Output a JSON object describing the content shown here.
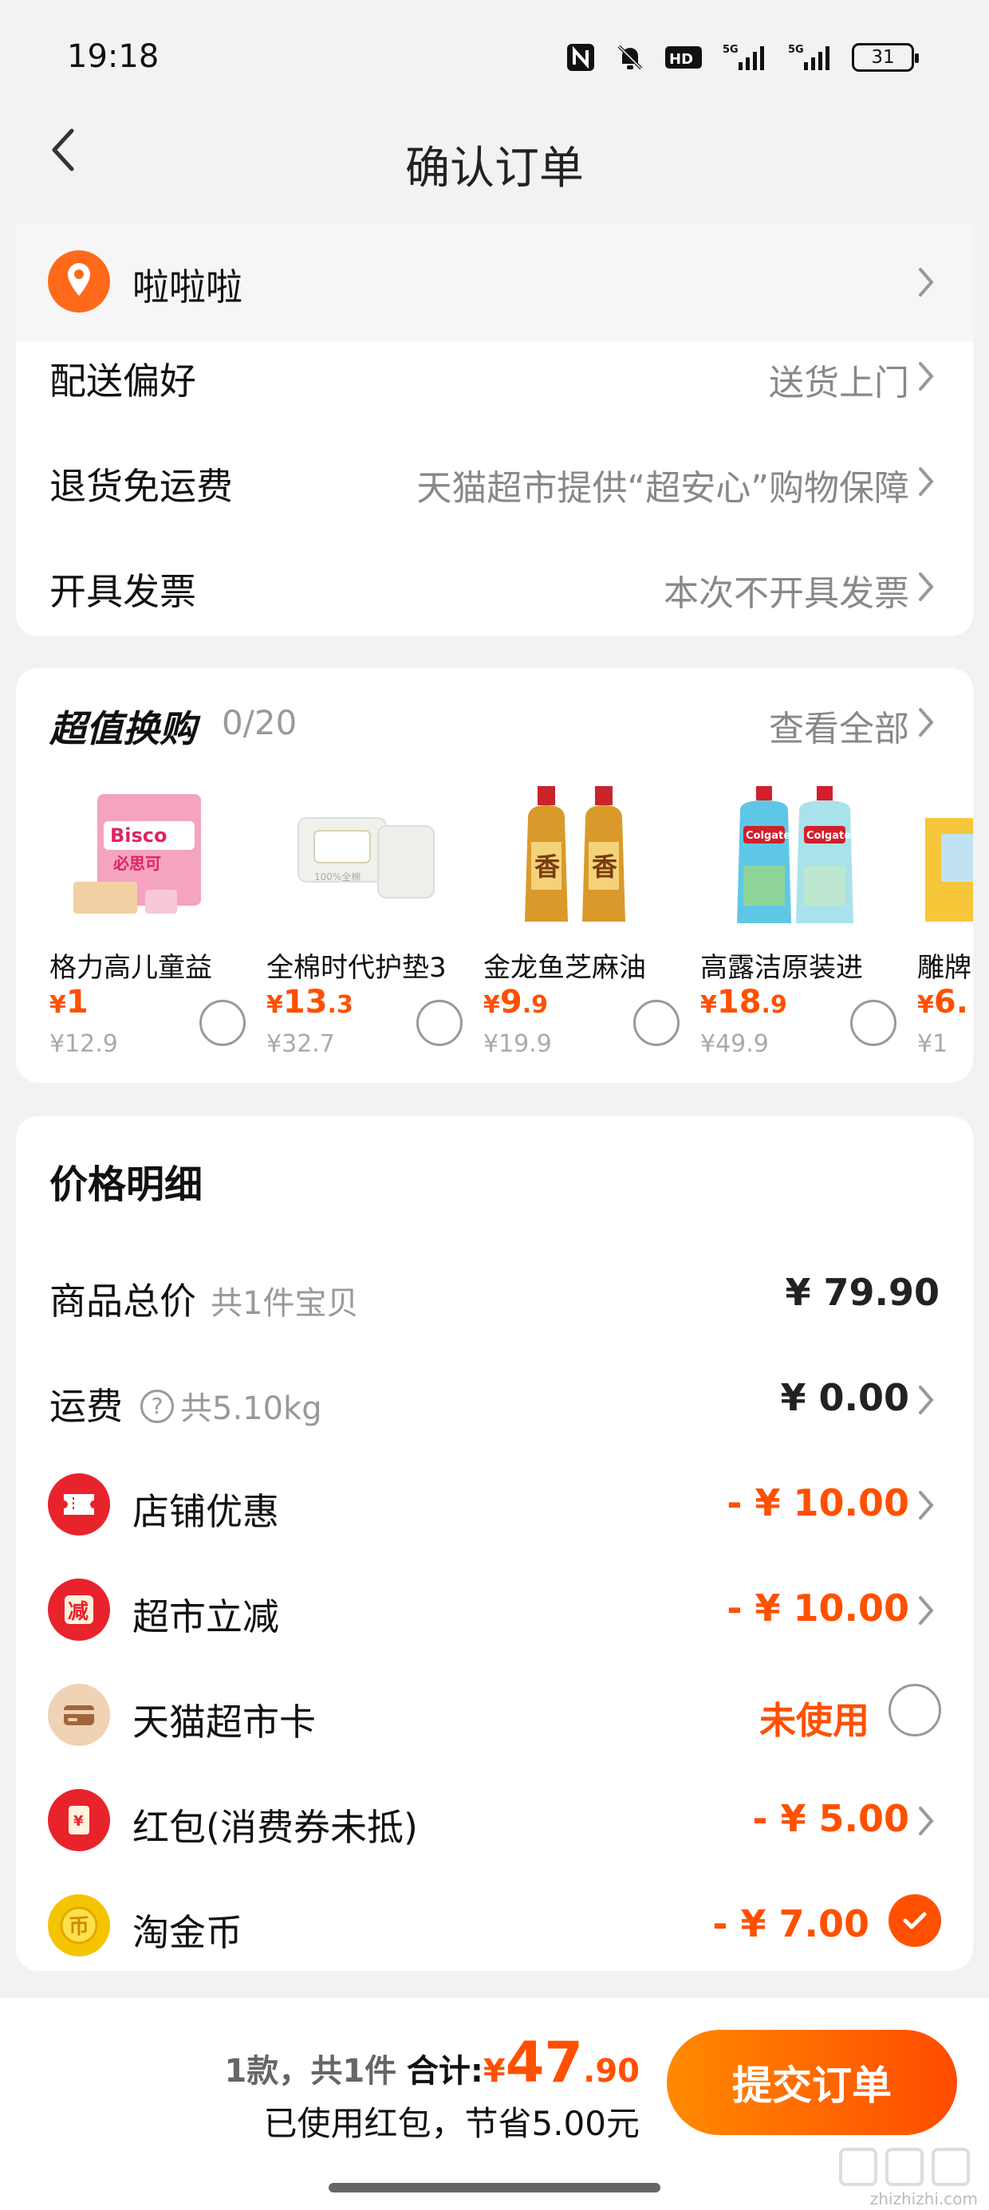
{
  "status_bar": {
    "time": "19:18",
    "network_1": "5G",
    "network_2": "5G",
    "hd_badge": "HD",
    "battery": "31",
    "icons": [
      "nfc-icon",
      "mute-bell-icon",
      "hd-icon",
      "signal-icon",
      "signal-icon",
      "battery-icon"
    ]
  },
  "nav": {
    "title": "确认订单",
    "back_icon": "chevron-left-icon"
  },
  "address": {
    "name": "啦啦啦",
    "icon": "location-pin-icon"
  },
  "options": [
    {
      "label": "配送偏好",
      "value": "送货上门"
    },
    {
      "label": "退货免运费",
      "value": "天猫超市提供“超安心”购物保障"
    },
    {
      "label": "开具发票",
      "value": "本次不开具发票"
    }
  ],
  "exchange": {
    "title": "超值换购",
    "count": "0/20",
    "view_all": "查看全部",
    "products": [
      {
        "name": "格力高儿童益",
        "price": "1",
        "price_dec": "",
        "orig": "¥12.9",
        "image_text": "Bisco\n必思可"
      },
      {
        "name": "全棉时代护垫3",
        "price": "13",
        "price_dec": ".3",
        "orig": "¥32.7",
        "image_text": "100%全棉"
      },
      {
        "name": "金龙鱼芝麻油",
        "price": "9",
        "price_dec": ".9",
        "orig": "¥19.9",
        "image_text": "香"
      },
      {
        "name": "高露洁原装进",
        "price": "18",
        "price_dec": ".9",
        "orig": "¥49.9",
        "image_text": "Colgate"
      },
      {
        "name": "雕牌",
        "price": "6.",
        "price_dec": "",
        "orig": "¥1",
        "image_text": ""
      }
    ]
  },
  "details": {
    "title": "价格明细",
    "rows": [
      {
        "label": "商品总价",
        "sub": "共1件宝贝",
        "amount": "¥ 79.90"
      },
      {
        "label": "运费",
        "sub": "共5.10kg",
        "amount": "¥ 0.00"
      },
      {
        "label": "店铺优惠",
        "amount": "- ¥ 10.00",
        "icon": "coupon-ticket-icon"
      },
      {
        "label": "超市立减",
        "amount": "- ¥ 10.00",
        "icon": "discount-icon",
        "icon_text": "减"
      },
      {
        "label": "天猫超市卡",
        "amount": "未使用",
        "icon": "card-icon"
      },
      {
        "label": "红包(消费券未抵)",
        "amount": "- ¥ 5.00",
        "icon": "red-packet-icon",
        "icon_text": "¥"
      },
      {
        "label": "淘金币",
        "amount": "- ¥ 7.00",
        "icon": "gold-coin-icon",
        "icon_text": "币"
      }
    ]
  },
  "bottom": {
    "count": "1款，共1件",
    "total_label": "合计:",
    "currency": "¥",
    "total_int": "47",
    "total_dec": ".90",
    "saved": "已使用红包，节省5.00元",
    "submit": "提交订单"
  },
  "watermark": {
    "text": "zhizhizhi.com"
  },
  "colors": {
    "accent": "#ff5000",
    "button_gradient_start": "#ff8a00",
    "button_gradient_end": "#ff4b00",
    "icon_red": "#e8232c",
    "icon_gold": "#f5c400",
    "icon_card": "#f0d2b4"
  }
}
